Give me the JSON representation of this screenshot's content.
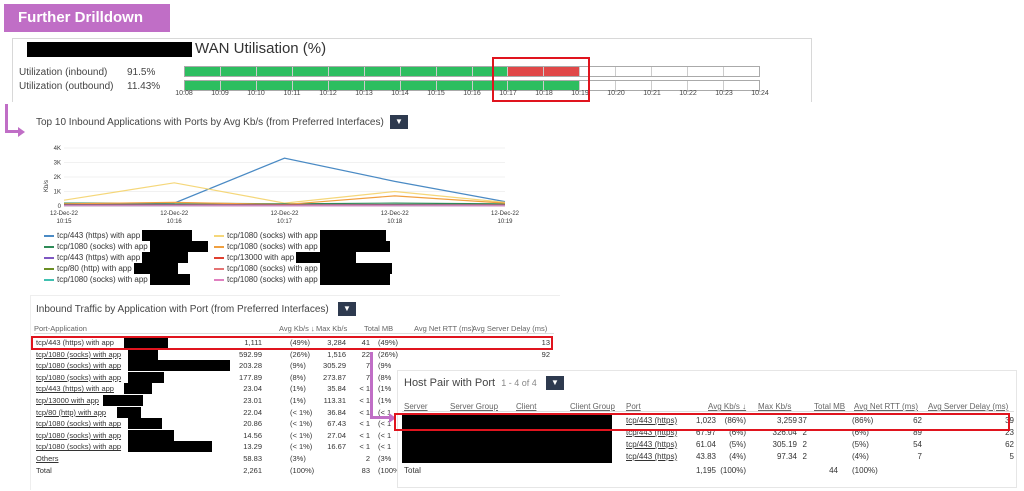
{
  "badge": "Further Drilldown",
  "wan": {
    "title": "WAN Utilisation (%)",
    "inbound_label": "Utilization (inbound)",
    "inbound_value": "91.5%",
    "outbound_label": "Utilization (outbound)",
    "outbound_value": "11.43%",
    "ticks": [
      "10:08",
      "10:09",
      "10:10",
      "10:11",
      "10:12",
      "10:13",
      "10:14",
      "10:15",
      "10:16",
      "10:17",
      "10:18",
      "10:19",
      "10:20",
      "10:21",
      "10:22",
      "10:23",
      "10:24"
    ]
  },
  "top10": {
    "title": "Top 10 Inbound Applications with Ports by Avg Kb/s (from Preferred Interfaces)"
  },
  "chart_data": {
    "type": "line",
    "ylabel": "Kb/s",
    "ylim": [
      0,
      4000
    ],
    "yticks": [
      "4K",
      "3K",
      "2K",
      "1K",
      "0"
    ],
    "categories": [
      "12-Dec-22 10:15",
      "12-Dec-22 10:16",
      "12-Dec-22 10:17",
      "12-Dec-22 10:18",
      "12-Dec-22 10:19"
    ],
    "series": [
      {
        "name": "tcp/443 (https) with app",
        "color": "#4a8ac4",
        "values": [
          100,
          200,
          3300,
          1700,
          300
        ]
      },
      {
        "name": "tcp/1080 (socks) with app",
        "color": "#f5d77a",
        "values": [
          400,
          1600,
          200,
          1000,
          250
        ]
      },
      {
        "name": "tcp/1080 (socks) with app",
        "color": "#2e8b57",
        "values": [
          200,
          200,
          150,
          200,
          150
        ]
      },
      {
        "name": "tcp/1080 (socks) with app",
        "color": "#f0a040",
        "values": [
          150,
          250,
          100,
          700,
          200
        ]
      },
      {
        "name": "tcp/443 (https) with app",
        "color": "#7e57c2",
        "values": [
          100,
          100,
          80,
          100,
          80
        ]
      },
      {
        "name": "tcp/13000 with app",
        "color": "#e04030",
        "values": [
          60,
          60,
          50,
          60,
          50
        ]
      },
      {
        "name": "tcp/80 (http) with app",
        "color": "#6b8e23",
        "values": [
          50,
          50,
          40,
          50,
          40
        ]
      },
      {
        "name": "tcp/1080 (socks) with app",
        "color": "#e57373",
        "values": [
          40,
          40,
          30,
          40,
          30
        ]
      },
      {
        "name": "tcp/1080 (socks) with app",
        "color": "#40c0b0",
        "values": [
          30,
          30,
          25,
          30,
          25
        ]
      },
      {
        "name": "tcp/1080 (socks) with app",
        "color": "#e080c0",
        "values": [
          20,
          20,
          15,
          20,
          15
        ]
      }
    ]
  },
  "legend": [
    {
      "label": "tcp/443 (https) with app",
      "color": "#4a8ac4"
    },
    {
      "label": "tcp/1080 (socks) with app",
      "color": "#2e8b57"
    },
    {
      "label": "tcp/443 (https) with app",
      "color": "#7e57c2"
    },
    {
      "label": "tcp/80 (http) with app",
      "color": "#6b8e23"
    },
    {
      "label": "tcp/1080 (socks) with app",
      "color": "#40c0b0"
    },
    {
      "label": "tcp/1080 (socks) with app",
      "color": "#f5d77a"
    },
    {
      "label": "tcp/1080 (socks) with app",
      "color": "#f0a040"
    },
    {
      "label": "tcp/13000 with app",
      "color": "#e04030"
    },
    {
      "label": "tcp/1080 (socks) with app",
      "color": "#e57373"
    },
    {
      "label": "tcp/1080 (socks) with app",
      "color": "#e080c0"
    }
  ],
  "inbound": {
    "title": "Inbound Traffic by Application with Port (from Preferred Interfaces)",
    "headers": [
      "Port-Application",
      "Avg Kb/s",
      "Max Kb/s",
      "Total MB",
      "Avg Net RTT (ms)",
      "Avg Server Delay (ms)"
    ],
    "rows": [
      [
        "tcp/443 (https) with app",
        "1,111",
        "(49%)",
        "3,284",
        "41",
        "(49%)",
        "",
        "13"
      ],
      [
        "tcp/1080 (socks) with app",
        "592.99",
        "(26%)",
        "1,516",
        "22",
        "(26%)",
        "",
        "92"
      ],
      [
        "tcp/1080 (socks) with app",
        "203.28",
        "(9%)",
        "305.29",
        "7",
        "(9%",
        "",
        ""
      ],
      [
        "tcp/1080 (socks) with app",
        "177.89",
        "(8%)",
        "273.87",
        "7",
        "(8%",
        "",
        ""
      ],
      [
        "tcp/443 (https) with app",
        "23.04",
        "(1%)",
        "35.84",
        "< 1",
        "(1%",
        "",
        ""
      ],
      [
        "tcp/13000 with app",
        "23.01",
        "(1%)",
        "113.31",
        "< 1",
        "(1%",
        "",
        ""
      ],
      [
        "tcp/80 (http) with app",
        "22.04",
        "(< 1%)",
        "36.84",
        "< 1",
        "(< 1",
        "",
        ""
      ],
      [
        "tcp/1080 (socks) with app",
        "20.86",
        "(< 1%)",
        "67.43",
        "< 1",
        "(< 1",
        "",
        ""
      ],
      [
        "tcp/1080 (socks) with app",
        "14.56",
        "(< 1%)",
        "27.04",
        "< 1",
        "(< 1",
        "",
        ""
      ],
      [
        "tcp/1080 (socks) with app",
        "13.29",
        "(< 1%)",
        "16.67",
        "< 1",
        "(< 1",
        "",
        ""
      ],
      [
        "Others",
        "58.83",
        "(3%)",
        "",
        "2",
        "(3%",
        "",
        ""
      ],
      [
        "Total",
        "2,261",
        "(100%)",
        "",
        "83",
        "(100%",
        "",
        ""
      ]
    ]
  },
  "hostpair": {
    "title": "Host Pair with Port",
    "count": "1 - 4 of 4",
    "headers": [
      "Server",
      "Server Group",
      "Client",
      "Client Group",
      "Port",
      "Avg Kb/s",
      "Max Kb/s",
      "Total MB",
      "Avg Net RTT (ms)",
      "Avg Server Delay (ms)"
    ],
    "rows": [
      [
        "tcp/443 (https)",
        "1,023",
        "(86%)",
        "3,259",
        "37",
        "(86%)",
        "62",
        "39"
      ],
      [
        "tcp/443 (https)",
        "67.97",
        "(6%)",
        "326.04",
        "2",
        "(6%)",
        "89",
        "23"
      ],
      [
        "tcp/443 (https)",
        "61.04",
        "(5%)",
        "305.19",
        "2",
        "(5%)",
        "54",
        "62"
      ],
      [
        "tcp/443 (https)",
        "43.83",
        "(4%)",
        "97.34",
        "2",
        "(4%)",
        "7",
        "5"
      ]
    ],
    "total": [
      "Total",
      "1,195",
      "(100%)",
      "44",
      "(100%)"
    ]
  }
}
